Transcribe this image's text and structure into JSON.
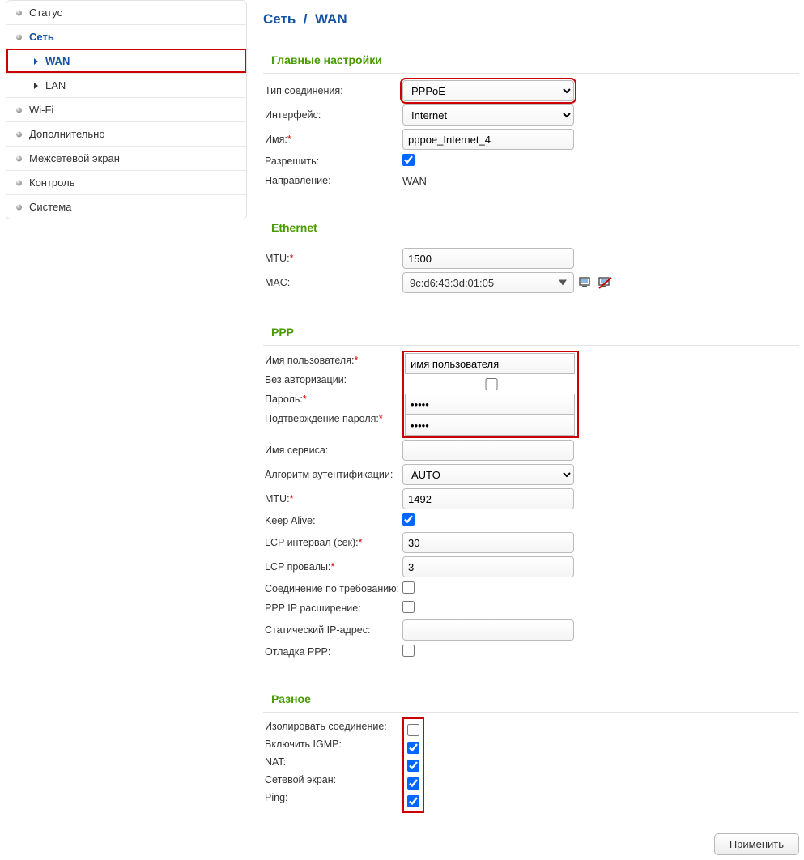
{
  "sidebar": {
    "items": [
      {
        "label": "Статус"
      },
      {
        "label": "Сеть",
        "active": true,
        "children": [
          {
            "label": "WAN",
            "selected": true
          },
          {
            "label": "LAN"
          }
        ]
      },
      {
        "label": "Wi-Fi"
      },
      {
        "label": "Дополнительно"
      },
      {
        "label": "Межсетевой экран"
      },
      {
        "label": "Контроль"
      },
      {
        "label": "Система"
      }
    ]
  },
  "breadcrumb": {
    "part1": "Сеть",
    "sep": "/",
    "part2": "WAN"
  },
  "sections": {
    "main": {
      "title": "Главные настройки",
      "conn_type_label": "Тип соединения:",
      "conn_type_value": "PPPoE",
      "iface_label": "Интерфейс:",
      "iface_value": "Internet",
      "name_label": "Имя:",
      "name_value": "pppoe_Internet_4",
      "allow_label": "Разрешить:",
      "allow_checked": true,
      "direction_label": "Направление:",
      "direction_value": "WAN"
    },
    "eth": {
      "title": "Ethernet",
      "mtu_label": "MTU:",
      "mtu_value": "1500",
      "mac_label": "MAC:",
      "mac_value": "9c:d6:43:3d:01:05"
    },
    "ppp": {
      "title": "PPP",
      "user_label": "Имя пользователя:",
      "user_value": "имя пользователя",
      "noauth_label": "Без авторизации:",
      "noauth_checked": false,
      "pass_label": "Пароль:",
      "pass_value": "•••••",
      "pass2_label": "Подтверждение пароля:",
      "pass2_value": "•••••",
      "svc_label": "Имя сервиса:",
      "svc_value": "",
      "auth_label": "Алгоритм аутентификации:",
      "auth_value": "AUTO",
      "mtu_label": "MTU:",
      "mtu_value": "1492",
      "keep_label": "Keep Alive:",
      "keep_checked": true,
      "lcp_int_label": "LCP интервал (сек):",
      "lcp_int_value": "30",
      "lcp_fail_label": "LCP провалы:",
      "lcp_fail_value": "3",
      "ondemand_label": "Соединение по требованию:",
      "ondemand_checked": false,
      "ipext_label": "PPP IP расширение:",
      "ipext_checked": false,
      "static_label": "Статический IP-адрес:",
      "static_value": "",
      "debug_label": "Отладка PPP:",
      "debug_checked": false
    },
    "misc": {
      "title": "Разное",
      "isolate_label": "Изолировать соединение:",
      "isolate_checked": false,
      "igmp_label": "Включить IGMP:",
      "igmp_checked": true,
      "nat_label": "NAT:",
      "nat_checked": true,
      "fw_label": "Сетевой экран:",
      "fw_checked": true,
      "ping_label": "Ping:",
      "ping_checked": true
    }
  },
  "buttons": {
    "apply": "Применить"
  }
}
